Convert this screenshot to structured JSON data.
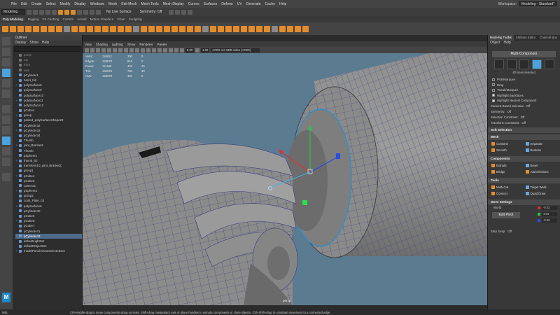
{
  "menubar": {
    "items": [
      "File",
      "Edit",
      "Create",
      "Select",
      "Modify",
      "Display",
      "Windows",
      "Mesh",
      "Edit Mesh",
      "Mesh Tools",
      "Mesh Display",
      "Curves",
      "Surfaces",
      "Deform",
      "UV",
      "Generate",
      "Cache",
      "Help"
    ],
    "workspace_label": "Workspace:",
    "workspace_value": "Modeling - Standard*"
  },
  "statusline": {
    "mode": "Modeling",
    "live_surface": "No Live Surface",
    "symmetry": "Symmetry: Off"
  },
  "shelf": {
    "tabs": [
      "Poly Modeling",
      "Rigging",
      "FX Caching",
      "Custom",
      "Arnold",
      "Motion Graphics",
      "XGen",
      "Sculpting"
    ],
    "active_tab": "Poly Modeling"
  },
  "outliner": {
    "title": "Outliner",
    "menu": [
      "Display",
      "Show",
      "Help"
    ],
    "items": [
      {
        "name": "persp",
        "dim": true
      },
      {
        "name": "top",
        "dim": true
      },
      {
        "name": "front",
        "dim": true
      },
      {
        "name": "side",
        "dim": true
      },
      {
        "name": "pCylinder1"
      },
      {
        "name": "hand_full"
      },
      {
        "name": "polySurface8"
      },
      {
        "name": "polySurface9"
      },
      {
        "name": "polySurface10"
      },
      {
        "name": "polySurface11"
      },
      {
        "name": "polySurface12"
      },
      {
        "name": "pCube4"
      },
      {
        "name": "group"
      },
      {
        "name": "pasted_polySurfaceShape23"
      },
      {
        "name": "pCylinder32"
      },
      {
        "name": "pCylinder33"
      },
      {
        "name": "pCylinder34"
      },
      {
        "name": "Thumb"
      },
      {
        "name": "joint_Bracket2"
      },
      {
        "name": "Thumb"
      },
      {
        "name": "pSphere1"
      },
      {
        "name": "thumb_02"
      },
      {
        "name": "transform10_joint_Bracket2"
      },
      {
        "name": "group1"
      },
      {
        "name": "pCube4"
      },
      {
        "name": "pCube5"
      },
      {
        "name": "camera1"
      },
      {
        "name": "pSphere3"
      },
      {
        "name": "group2"
      },
      {
        "name": "Joint_Plate_03"
      },
      {
        "name": "polySurface6"
      },
      {
        "name": "pCylinder40"
      },
      {
        "name": "pCube6"
      },
      {
        "name": "pCube8"
      },
      {
        "name": "pCube7"
      },
      {
        "name": "pCylinder41"
      },
      {
        "name": "pCylinder43",
        "selected": true
      },
      {
        "name": "defaultLightSet"
      },
      {
        "name": "defaultObjectSet"
      },
      {
        "name": "modelPanel4ViewSelectedSet"
      }
    ]
  },
  "viewport": {
    "menu": [
      "View",
      "Shading",
      "Lighting",
      "Show",
      "Renderer",
      "Panels"
    ],
    "field1": "0.00",
    "field2": "1.00",
    "colorspace": "ACES 1.0 SDR-video (ACES)",
    "hud": [
      {
        "label": "Verts:",
        "v1": "116812",
        "v2": "300",
        "v3": "0"
      },
      {
        "label": "Edges:",
        "v1": "183570",
        "v2": "610",
        "v3": "0"
      },
      {
        "label": "Faces:",
        "v1": "111466",
        "v2": "402",
        "v3": "40"
      },
      {
        "label": "Tris:",
        "v1": "192976",
        "v2": "790",
        "v3": "40"
      },
      {
        "label": "UVs:",
        "v1": "146378",
        "v2": "484",
        "v3": "0"
      }
    ],
    "camera_label": "persp"
  },
  "modeling_toolkit": {
    "tabs": [
      "Modeling Toolkit",
      "Attribute Editor",
      "Channel Box"
    ],
    "menu": [
      "Object",
      "Help"
    ],
    "multi_component": "Multi-Component",
    "faces_selected": "40 faces selected",
    "select_options": [
      {
        "label": "Pick/Marquee",
        "checked": false
      },
      {
        "label": "Drag",
        "checked": false
      },
      {
        "label": "Tweak/Marquee",
        "checked": false
      },
      {
        "label": "Highlight Backfaces",
        "checked": true
      },
      {
        "label": "Highlight Nearest Component",
        "checked": true
      }
    ],
    "camera_based": {
      "label": "Camera-Based Selection",
      "value": "Off"
    },
    "symmetry": {
      "label": "Symmetry:",
      "value": "Off"
    },
    "selection_constraint": {
      "label": "Selection Constraint:",
      "value": "Off"
    },
    "transform_constraint": {
      "label": "Transform Constraint:",
      "value": "Off"
    },
    "soft_selection": "Soft Selection",
    "mesh_title": "Mesh",
    "mesh_buttons": [
      "Combine",
      "Separate",
      "Smooth",
      "Boolean"
    ],
    "components_title": "Components",
    "component_buttons": [
      "Extrude",
      "Bevel",
      "Bridge",
      "Add Divisions"
    ],
    "tools_title": "Tools",
    "tool_buttons": [
      "Multi-Cut",
      "Target Weld",
      "Connect",
      "Quad Draw"
    ],
    "move_settings": "Move Settings",
    "axis": "World",
    "edit_pivot": "Edit Pivot",
    "move_values": {
      "x": "-0.02",
      "y": "4.04",
      "z": "-0.65"
    },
    "step_snap": {
      "label": "Step Snap:",
      "value": "Off"
    }
  },
  "helpline": {
    "mel": "MEL",
    "text": "Ctrl+middle-drag to move components along normals. Shift+drag manipulator axis or plane handles to extrude components or clone objects. Ctrl+Shift+drag to constrain movement to a connected edge."
  },
  "colors": {
    "accent_blue": "#4aa3df",
    "shelf_orange": "#e58c2a",
    "viewport_bg": "#5b7b91"
  }
}
